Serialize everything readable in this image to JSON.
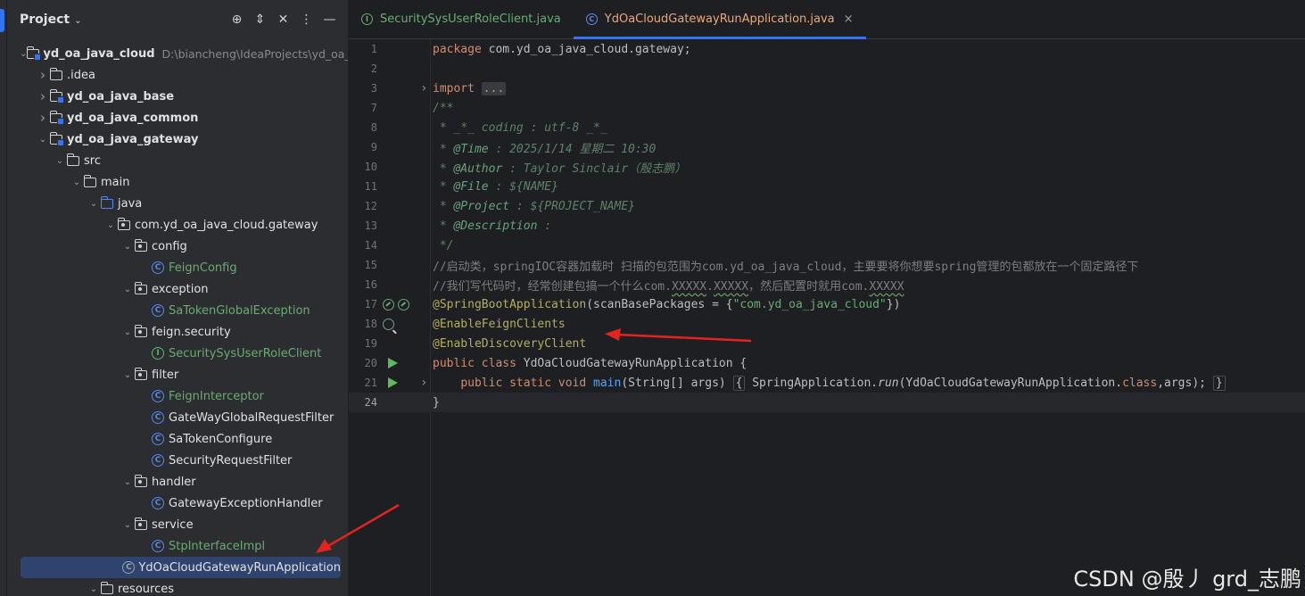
{
  "project_panel": {
    "title": "Project",
    "tree": [
      {
        "indent": 0,
        "arrow": "open",
        "icon": "module-folder",
        "label": "yd_oa_java_cloud",
        "bold": true,
        "path": "D:\\biancheng\\IdeaProjects\\yd_oa_j"
      },
      {
        "indent": 1,
        "arrow": "closed",
        "icon": "folder",
        "label": ".idea"
      },
      {
        "indent": 1,
        "arrow": "closed",
        "icon": "module-folder",
        "label": "yd_oa_java_base",
        "bold": true
      },
      {
        "indent": 1,
        "arrow": "closed",
        "icon": "module-folder",
        "label": "yd_oa_java_common",
        "bold": true
      },
      {
        "indent": 1,
        "arrow": "open",
        "icon": "module-folder",
        "label": "yd_oa_java_gateway",
        "bold": true
      },
      {
        "indent": 2,
        "arrow": "open",
        "icon": "folder",
        "label": "src"
      },
      {
        "indent": 3,
        "arrow": "open",
        "icon": "folder",
        "label": "main"
      },
      {
        "indent": 4,
        "arrow": "open",
        "icon": "source-folder",
        "label": "java"
      },
      {
        "indent": 5,
        "arrow": "open",
        "icon": "package",
        "label": "com.yd_oa_java_cloud.gateway"
      },
      {
        "indent": 6,
        "arrow": "open",
        "icon": "package",
        "label": "config"
      },
      {
        "indent": 7,
        "arrow": "",
        "icon": "class",
        "label": "FeignConfig",
        "green": true
      },
      {
        "indent": 6,
        "arrow": "open",
        "icon": "package",
        "label": "exception"
      },
      {
        "indent": 7,
        "arrow": "",
        "icon": "class",
        "label": "SaTokenGlobalException",
        "green": true
      },
      {
        "indent": 6,
        "arrow": "open",
        "icon": "package",
        "label": "feign.security"
      },
      {
        "indent": 7,
        "arrow": "",
        "icon": "interface",
        "label": "SecuritySysUserRoleClient",
        "green": true
      },
      {
        "indent": 6,
        "arrow": "open",
        "icon": "package",
        "label": "filter"
      },
      {
        "indent": 7,
        "arrow": "",
        "icon": "class",
        "label": "FeignInterceptor",
        "green": true
      },
      {
        "indent": 7,
        "arrow": "",
        "icon": "class",
        "label": "GateWayGlobalRequestFilter"
      },
      {
        "indent": 7,
        "arrow": "",
        "icon": "class",
        "label": "SaTokenConfigure"
      },
      {
        "indent": 7,
        "arrow": "",
        "icon": "class",
        "label": "SecurityRequestFilter"
      },
      {
        "indent": 6,
        "arrow": "open",
        "icon": "package",
        "label": "handler"
      },
      {
        "indent": 7,
        "arrow": "",
        "icon": "class",
        "label": "GatewayExceptionHandler"
      },
      {
        "indent": 6,
        "arrow": "open",
        "icon": "package",
        "label": "service"
      },
      {
        "indent": 7,
        "arrow": "",
        "icon": "class",
        "label": "StpInterfaceImpl",
        "green": true
      },
      {
        "indent": 6,
        "arrow": "",
        "icon": "spring-class",
        "label": "YdOaCloudGatewayRunApplication",
        "selected": true
      },
      {
        "indent": 4,
        "arrow": "open",
        "icon": "folder",
        "label": "resources"
      }
    ]
  },
  "tabs": [
    {
      "label": "SecuritySysUserRoleClient.java",
      "icon": "interface-icon",
      "active": false
    },
    {
      "label": "YdOaCloudGatewayRunApplication.java",
      "icon": "class-icon",
      "active": true
    }
  ],
  "code_lines": [
    {
      "n": "1",
      "html": "<span class=\"kw\">package </span><span class=\"pl\">com.yd_oa_java_cloud.gateway;</span>"
    },
    {
      "n": "2",
      "html": ""
    },
    {
      "n": "3",
      "fold": true,
      "html": "<span class=\"kw\">import </span><span class=\"fold-box\">...</span>"
    },
    {
      "n": "7",
      "html": "<span class=\"doc\">/**</span>"
    },
    {
      "n": "8",
      "html": "<span class=\"doc\"> * _*_ coding : utf-8 _*_</span>"
    },
    {
      "n": "9",
      "html": "<span class=\"doc\"> * </span><span class=\"tag\">@Time</span><span class=\"doc\"> : 2025/1/14 星期二 10:30</span>"
    },
    {
      "n": "10",
      "html": "<span class=\"doc\"> * </span><span class=\"tag\">@Author</span><span class=\"doc\"> : Taylor Sinclair（殷志鹏）</span>"
    },
    {
      "n": "11",
      "html": "<span class=\"doc\"> * </span><span class=\"tag\">@File</span><span class=\"doc\"> : ${NAME}</span>"
    },
    {
      "n": "12",
      "html": "<span class=\"doc\"> * </span><span class=\"tag\">@Project</span><span class=\"doc\"> : ${PROJECT_NAME}</span>"
    },
    {
      "n": "13",
      "html": "<span class=\"doc\"> * </span><span class=\"tag\">@Description</span><span class=\"doc\"> :</span>"
    },
    {
      "n": "14",
      "html": "<span class=\"doc\"> */</span>"
    },
    {
      "n": "15",
      "html": "<span class=\"cm\">//启动类，springIOC容器加载时 扫描的包范围为com.yd_oa_java_cloud，主要要将你想要spring管理的包都放在一个固定路径下</span>"
    },
    {
      "n": "16",
      "html": "<span class=\"cm\">//我们写代码时，经常创建包搞一个什么com.<span class=\"typo\">XXXXX</span>.<span class=\"typo\">XXXXX</span>，然后配置时就用com.<span class=\"typo\">XXXXX</span></span>"
    },
    {
      "n": "17",
      "gutter": [
        "bean",
        "bean"
      ],
      "html": "<span class=\"an\">@SpringBootApplication</span><span class=\"pl\">(scanBasePackages = {</span><span class=\"str\">\"com.yd_oa_java_cloud\"</span><span class=\"pl\">})</span>"
    },
    {
      "n": "18",
      "gutter": [
        "search"
      ],
      "html": "<span class=\"an\">@EnableFeignClients</span>"
    },
    {
      "n": "19",
      "html": "<span class=\"an\">@EnableDiscoveryClient</span>"
    },
    {
      "n": "20",
      "gutter": [
        "run"
      ],
      "html": "<span class=\"kw\">public class </span><span class=\"pl\">YdOaCloudGatewayRunApplication {</span>"
    },
    {
      "n": "21",
      "gutter": [
        "run"
      ],
      "fold": true,
      "html": "<span class=\"pl\">    </span><span class=\"kw\">public static void </span><span class=\"fn\">main</span><span class=\"pl\">(String[] args) </span><span class=\"brace-box pl\">{</span><span class=\"pl\"> SpringApplication.</span><span class=\"it\">run</span><span class=\"pl\">(YdOaCloudGatewayRunApplication.</span><span class=\"kw\">class</span><span class=\"pl\">,args); </span><span class=\"brace-box pl\">}</span>"
    },
    {
      "n": "24",
      "current": true,
      "html": "<span class=\"pl\">}</span>"
    }
  ],
  "watermark": "CSDN @殷丿 grd_志鹏",
  "colors": {
    "accent": "#3574f0",
    "annotation_arrow": "#e0241f"
  }
}
